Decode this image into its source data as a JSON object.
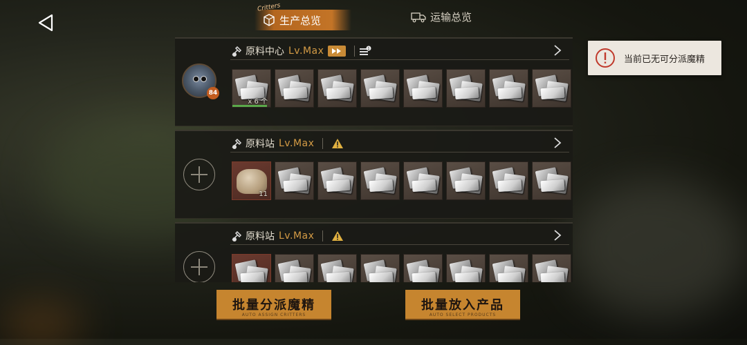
{
  "tabs": {
    "production": {
      "label": "生产总览",
      "tag": "Critters"
    },
    "transport": {
      "label": "运输总览"
    }
  },
  "toast": {
    "text": "当前已无可分派魔精"
  },
  "panels": [
    {
      "name": "原料中心",
      "level": "Lv.Max",
      "has_critter": true,
      "critter_badge": "84",
      "status_icon": "speed-up-icon",
      "items": [
        {
          "count": "x 6 个",
          "kind": "metal"
        },
        {
          "kind": "metal"
        },
        {
          "kind": "metal"
        },
        {
          "kind": "metal"
        },
        {
          "kind": "metal"
        },
        {
          "kind": "metal"
        },
        {
          "kind": "metal"
        },
        {
          "kind": "metal"
        }
      ]
    },
    {
      "name": "原料站",
      "level": "Lv.Max",
      "has_critter": false,
      "status_icon": "warning-icon",
      "items": [
        {
          "count": "11",
          "kind": "sack"
        },
        {
          "kind": "metal"
        },
        {
          "kind": "metal"
        },
        {
          "kind": "metal"
        },
        {
          "kind": "metal"
        },
        {
          "kind": "metal"
        },
        {
          "kind": "metal"
        },
        {
          "kind": "metal"
        }
      ]
    },
    {
      "name": "原料站",
      "level": "Lv.Max",
      "has_critter": false,
      "status_icon": "warning-icon",
      "items": [
        {
          "kind": "metal"
        },
        {
          "kind": "metal"
        },
        {
          "kind": "metal"
        },
        {
          "kind": "metal"
        },
        {
          "kind": "metal"
        },
        {
          "kind": "metal"
        },
        {
          "kind": "metal"
        },
        {
          "kind": "metal"
        }
      ]
    }
  ],
  "buttons": {
    "assign": {
      "label": "批量分派魔精",
      "sub": "AUTO ASSIGN CRITTERS"
    },
    "place": {
      "label": "批量放入产品",
      "sub": "AUTO SELECT PRODUCTS"
    }
  },
  "colors": {
    "accent": "#c6852f",
    "level": "#d49b45",
    "warning": "#e0b040"
  }
}
